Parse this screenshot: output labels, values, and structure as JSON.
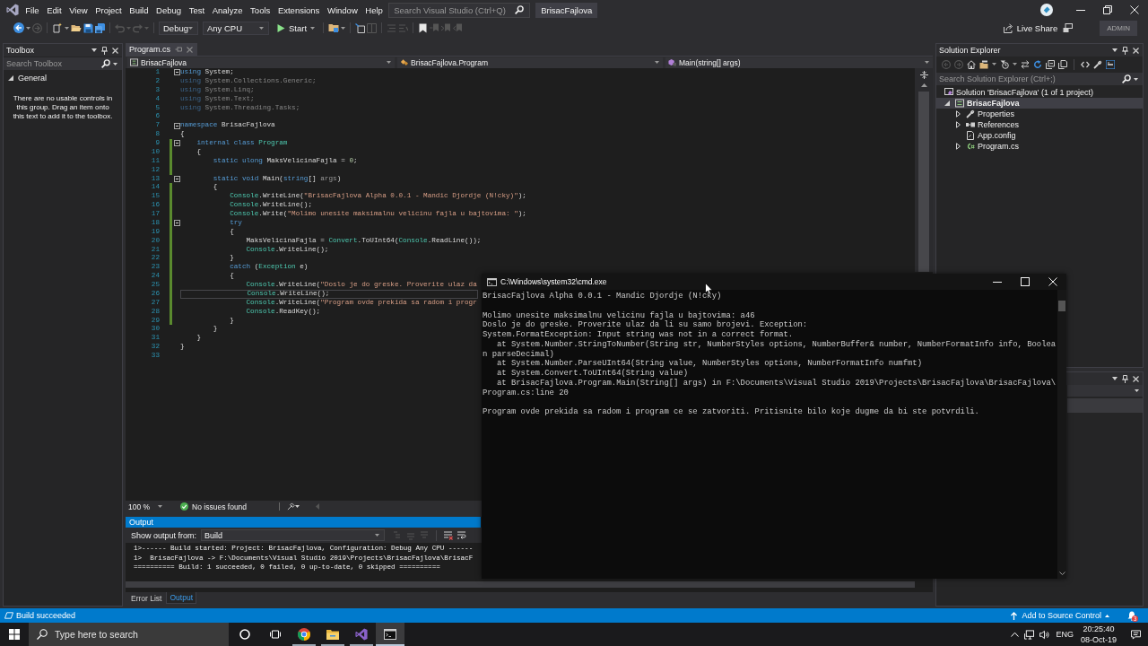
{
  "menu_bar": {
    "items": [
      "File",
      "Edit",
      "View",
      "Project",
      "Build",
      "Debug",
      "Test",
      "Analyze",
      "Tools",
      "Extensions",
      "Window",
      "Help"
    ],
    "search": {
      "placeholder": "Search Visual Studio (Ctrl+Q)"
    },
    "solution_name": "BrisacFajlova"
  },
  "toolbar": {
    "configuration": "Debug",
    "platform": "Any CPU",
    "start": "Start",
    "live_share": "Live Share",
    "account": "ADMIN"
  },
  "toolbox": {
    "title": "Toolbox",
    "search": {
      "placeholder": "Search Toolbox"
    },
    "group": {
      "label": "General",
      "expanded": true
    },
    "empty_message": "There are no usable controls in this group. Drag an item onto this text to add it to the toolbox."
  },
  "editor": {
    "tabs": [
      {
        "label": "Program.cs",
        "selected": true
      }
    ],
    "navigation": {
      "project": "BrisacFajlova",
      "type": "BrisacFajlova.Program",
      "member": "Main(string[] args)"
    },
    "lines": [
      {
        "n": "1",
        "fold": true,
        "changed": false,
        "current": false,
        "tokens": [
          {
            "kind": "keyword",
            "text": "using"
          },
          {
            "kind": "plain",
            "text": " System;"
          }
        ]
      },
      {
        "n": "2",
        "fold": false,
        "changed": false,
        "current": false,
        "tokens": [
          {
            "kind": "faded_keyword",
            "text": "using"
          },
          {
            "kind": "faded",
            "text": " System.Collections.Generic;"
          }
        ]
      },
      {
        "n": "3",
        "fold": false,
        "changed": false,
        "current": false,
        "tokens": [
          {
            "kind": "faded_keyword",
            "text": "using"
          },
          {
            "kind": "faded",
            "text": " System.Linq;"
          }
        ]
      },
      {
        "n": "4",
        "fold": false,
        "changed": false,
        "current": false,
        "tokens": [
          {
            "kind": "faded_keyword",
            "text": "using"
          },
          {
            "kind": "faded",
            "text": " System.Text;"
          }
        ]
      },
      {
        "n": "5",
        "fold": false,
        "changed": false,
        "current": false,
        "tokens": [
          {
            "kind": "faded_keyword",
            "text": "using"
          },
          {
            "kind": "faded",
            "text": " System.Threading.Tasks;"
          }
        ]
      },
      {
        "n": "6",
        "fold": false,
        "changed": false,
        "current": false
      },
      {
        "n": "7",
        "fold": true,
        "changed": false,
        "current": false,
        "tokens": [
          {
            "kind": "keyword",
            "text": "namespace"
          },
          {
            "kind": "plain",
            "text": " BrisacFajlova"
          }
        ]
      },
      {
        "n": "8",
        "fold": false,
        "changed": false,
        "current": false,
        "tokens": [
          {
            "kind": "plain",
            "text": "{"
          }
        ]
      },
      {
        "n": "9",
        "fold": true,
        "changed": true,
        "current": false,
        "tokens": [
          {
            "kind": "keyword",
            "text": "    internal class "
          },
          {
            "kind": "type",
            "text": "Program"
          }
        ]
      },
      {
        "n": "10",
        "fold": false,
        "changed": true,
        "current": false,
        "tokens": [
          {
            "kind": "plain",
            "text": "    {"
          }
        ]
      },
      {
        "n": "11",
        "fold": false,
        "changed": true,
        "current": false,
        "tokens": [
          {
            "kind": "keyword",
            "text": "        static ulong"
          },
          {
            "kind": "plain",
            "text": " MaksVelicinaFajla = "
          },
          {
            "kind": "number",
            "text": "0"
          },
          {
            "kind": "plain",
            "text": ";"
          }
        ]
      },
      {
        "n": "12",
        "fold": false,
        "changed": true,
        "current": false
      },
      {
        "n": "13",
        "fold": true,
        "changed": false,
        "current": false,
        "tokens": [
          {
            "kind": "keyword",
            "text": "        static void"
          },
          {
            "kind": "plain",
            "text": " Main("
          },
          {
            "kind": "keyword",
            "text": "string"
          },
          {
            "kind": "plain",
            "text": "[] "
          },
          {
            "kind": "unused",
            "text": "args"
          },
          {
            "kind": "plain",
            "text": ")"
          }
        ]
      },
      {
        "n": "14",
        "fold": false,
        "changed": true,
        "current": false,
        "tokens": [
          {
            "kind": "plain",
            "text": "        {"
          }
        ]
      },
      {
        "n": "15",
        "fold": false,
        "changed": true,
        "current": false,
        "tokens": [
          {
            "kind": "type",
            "text": "            Console"
          },
          {
            "kind": "plain",
            "text": ".WriteLine("
          },
          {
            "kind": "string",
            "text": "\"BrisacFajlova Alpha 0.0.1 - Mandic Djordje (N!cky)\""
          },
          {
            "kind": "plain",
            "text": ");"
          }
        ]
      },
      {
        "n": "16",
        "fold": false,
        "changed": true,
        "current": false,
        "tokens": [
          {
            "kind": "type",
            "text": "            Console"
          },
          {
            "kind": "plain",
            "text": ".WriteLine();"
          }
        ]
      },
      {
        "n": "17",
        "fold": false,
        "changed": true,
        "current": false,
        "tokens": [
          {
            "kind": "type",
            "text": "            Console"
          },
          {
            "kind": "plain",
            "text": ".Write("
          },
          {
            "kind": "string",
            "text": "\"Molimo unesite maksimalnu velicinu fajla u bajtovima: \""
          },
          {
            "kind": "plain",
            "text": ");"
          }
        ]
      },
      {
        "n": "18",
        "fold": true,
        "changed": true,
        "current": false,
        "tokens": [
          {
            "kind": "keyword",
            "text": "            try"
          }
        ]
      },
      {
        "n": "19",
        "fold": false,
        "changed": true,
        "current": false,
        "tokens": [
          {
            "kind": "plain",
            "text": "            {"
          }
        ]
      },
      {
        "n": "20",
        "fold": false,
        "changed": true,
        "current": false,
        "tokens": [
          {
            "kind": "plain",
            "text": "                MaksVelicinaFajla = "
          },
          {
            "kind": "type",
            "text": "Convert"
          },
          {
            "kind": "plain",
            "text": ".ToUInt64("
          },
          {
            "kind": "type",
            "text": "Console"
          },
          {
            "kind": "plain",
            "text": ".ReadLine());"
          }
        ]
      },
      {
        "n": "21",
        "fold": false,
        "changed": true,
        "current": false,
        "tokens": [
          {
            "kind": "type",
            "text": "                Console"
          },
          {
            "kind": "plain",
            "text": ".WriteLine();"
          }
        ]
      },
      {
        "n": "22",
        "fold": false,
        "changed": true,
        "current": false,
        "tokens": [
          {
            "kind": "plain",
            "text": "            }"
          }
        ]
      },
      {
        "n": "23",
        "fold": false,
        "changed": true,
        "current": false,
        "tokens": [
          {
            "kind": "keyword",
            "text": "            catch"
          },
          {
            "kind": "plain",
            "text": " ("
          },
          {
            "kind": "type",
            "text": "Exception"
          },
          {
            "kind": "plain",
            "text": " e)"
          }
        ]
      },
      {
        "n": "24",
        "fold": false,
        "changed": true,
        "current": false,
        "tokens": [
          {
            "kind": "plain",
            "text": "            {"
          }
        ]
      },
      {
        "n": "25",
        "fold": false,
        "changed": true,
        "current": false,
        "tokens": [
          {
            "kind": "type",
            "text": "                Console"
          },
          {
            "kind": "plain",
            "text": ".WriteLine("
          },
          {
            "kind": "string",
            "text": "\"Doslo je do greske. Proverite ulaz da"
          }
        ]
      },
      {
        "n": "26",
        "fold": false,
        "changed": true,
        "current": true,
        "tokens": [
          {
            "kind": "type",
            "text": "                Console"
          },
          {
            "kind": "plain",
            "text": ".WriteLine();"
          }
        ]
      },
      {
        "n": "27",
        "fold": false,
        "changed": true,
        "current": false,
        "tokens": [
          {
            "kind": "type",
            "text": "                Console"
          },
          {
            "kind": "plain",
            "text": ".WriteLine("
          },
          {
            "kind": "string",
            "text": "\"Program ovde prekida sa radom i progr"
          }
        ]
      },
      {
        "n": "28",
        "fold": false,
        "changed": true,
        "current": false,
        "tokens": [
          {
            "kind": "type",
            "text": "                Console"
          },
          {
            "kind": "plain",
            "text": ".ReadKey();"
          }
        ]
      },
      {
        "n": "29",
        "fold": false,
        "changed": true,
        "current": false,
        "tokens": [
          {
            "kind": "plain",
            "text": "            }"
          }
        ]
      },
      {
        "n": "30",
        "fold": false,
        "changed": false,
        "current": false,
        "tokens": [
          {
            "kind": "plain",
            "text": "        }"
          }
        ]
      },
      {
        "n": "31",
        "fold": false,
        "changed": false,
        "current": false,
        "tokens": [
          {
            "kind": "plain",
            "text": "    }"
          }
        ]
      },
      {
        "n": "32",
        "fold": false,
        "changed": false,
        "current": false,
        "tokens": [
          {
            "kind": "plain",
            "text": "}"
          }
        ]
      },
      {
        "n": "33",
        "fold": false,
        "changed": false,
        "current": false
      }
    ],
    "zoom": "100 %",
    "issues": "No issues found"
  },
  "output": {
    "title": "Output",
    "source_label": "Show output from:",
    "source": "Build",
    "lines": [
      "1>------ Build started: Project: BrisacFajlova, Configuration: Debug Any CPU ------",
      "1>  BrisacFajlova -> F:\\Documents\\Visual Studio 2019\\Projects\\BrisacFajlova\\BrisacF",
      "========== Build: 1 succeeded, 0 failed, 0 up-to-date, 0 skipped =========="
    ],
    "tabs": [
      {
        "label": "Error List",
        "selected": false
      },
      {
        "label": "Output",
        "selected": true
      }
    ]
  },
  "solution_explorer": {
    "title": "Solution Explorer",
    "search": {
      "placeholder": "Search Solution Explorer (Ctrl+;)"
    },
    "preview_selected_items": true,
    "tree": [
      {
        "label": "Solution 'BrisacFajlova' (1 of 1 project)",
        "kind": "solution",
        "selected": false,
        "startup": false,
        "children": [
          {
            "label": "BrisacFajlova",
            "kind": "project",
            "expanded": true,
            "selected": true,
            "startup": true,
            "children": [
              {
                "label": "Properties",
                "kind": "properties",
                "expanded": false,
                "selected": false,
                "startup": false
              },
              {
                "label": "References",
                "kind": "references",
                "expanded": false,
                "selected": false,
                "startup": false
              },
              {
                "label": "App.config",
                "kind": "config",
                "selected": false,
                "startup": false
              },
              {
                "label": "Program.cs",
                "kind": "csharp_file",
                "expanded": false,
                "selected": false,
                "startup": false
              }
            ]
          }
        ]
      }
    ]
  },
  "console_window": {
    "title": "C:\\Windows\\system32\\cmd.exe",
    "blocks": [
      [
        "BrisacFajlova Alpha 0.0.1 - Mandic Djordje (N!cky)"
      ],
      [
        "Molimo unesite maksimalnu velicinu fajla u bajtovima: a46",
        "Doslo je do greske. Proverite ulaz da li su samo brojevi. Exception:",
        "System.FormatException: Input string was not in a correct format.",
        "   at System.Number.StringToNumber(String str, NumberStyles options, NumberBuffer& number, NumberFormatInfo info, Boolean parseDecimal)",
        "   at System.Number.ParseUInt64(String value, NumberStyles options, NumberFormatInfo numfmt)",
        "   at System.Convert.ToUInt64(String value)",
        "   at BrisacFajlova.Program.Main(String[] args) in F:\\Documents\\Visual Studio 2019\\Projects\\BrisacFajlova\\BrisacFajlova\\Program.cs:line 20"
      ],
      [
        "Program ovde prekida sa radom i program ce se zatvoriti. Pritisnite bilo koje dugme da bi ste potvrdili."
      ]
    ]
  },
  "status_bar": {
    "message": "Build succeeded",
    "source_control": "Add to Source Control",
    "notification_count": "3"
  },
  "taskbar": {
    "search": {
      "placeholder": "Type here to search"
    },
    "apps": [
      {
        "kind": "browser",
        "running": true,
        "selected": false
      },
      {
        "kind": "folder",
        "running": true,
        "selected": false
      },
      {
        "kind": "ide",
        "running": true,
        "selected": false
      },
      {
        "kind": "terminal",
        "running": true,
        "selected": true
      }
    ],
    "language": "ENG",
    "time": "20:25:40",
    "date": "08-Oct-19"
  }
}
